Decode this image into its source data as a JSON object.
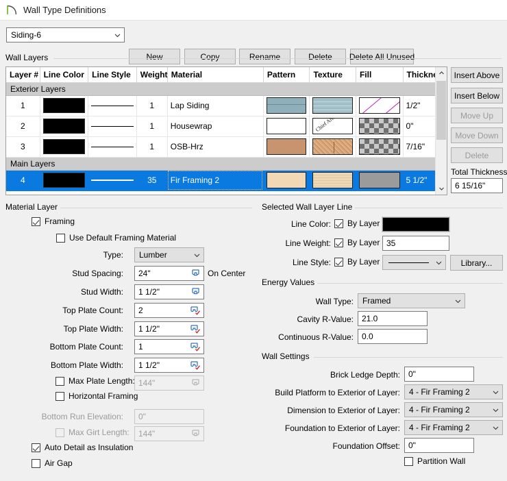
{
  "window": {
    "title": "Wall Type Definitions",
    "icon": "wall-arc-icon"
  },
  "toolbar": {
    "wall_type_value": "Siding-6",
    "buttons": [
      {
        "label": "New",
        "name": "new-button"
      },
      {
        "label": "Copy",
        "name": "copy-button"
      },
      {
        "label": "Rename",
        "name": "rename-button"
      },
      {
        "label": "Delete",
        "name": "delete-button"
      },
      {
        "label": "Delete All Unused",
        "name": "delete-all-unused-button"
      }
    ]
  },
  "wall_layers": {
    "group_title": "Wall Layers",
    "columns": [
      "Layer #",
      "Line Color",
      "Line Style",
      "Weight",
      "Material",
      "Pattern",
      "Texture",
      "Fill",
      "Thickness"
    ],
    "sections": [
      {
        "label": "Exterior Layers",
        "rows": [
          {
            "layer": "1",
            "line_color": "#000000",
            "line_style": "solid",
            "weight": "1",
            "material": "Lap Siding",
            "pattern": "lap-siding-pattern",
            "texture": "lap-siding-texture",
            "fill": "diagonal-magenta-fill",
            "thickness": "1/2\"",
            "selected": false
          },
          {
            "layer": "2",
            "line_color": "#000000",
            "line_style": "solid",
            "weight": "1",
            "material": "Housewrap",
            "pattern": "white-pattern",
            "texture": "housewrap-texture",
            "fill": "checker-fill",
            "thickness": "0\"",
            "selected": false
          },
          {
            "layer": "3",
            "line_color": "#000000",
            "line_style": "solid",
            "weight": "1",
            "material": "OSB-Hrz",
            "pattern": "osb-pattern",
            "texture": "osb-texture",
            "fill": "checker-fill",
            "thickness": "7/16\"",
            "selected": false
          }
        ]
      },
      {
        "label": "Main Layers",
        "rows": [
          {
            "layer": "4",
            "line_color": "#000000",
            "line_style": "solid",
            "weight": "35",
            "material": "Fir Framing 2",
            "pattern": "fir-pattern",
            "texture": "fir-texture",
            "fill": "gray-fill",
            "thickness": "5 1/2\"",
            "selected": true
          }
        ]
      }
    ],
    "texture_watermark": "Chief Architect"
  },
  "side_buttons": {
    "insert_above": "Insert Above",
    "insert_below": "Insert Below",
    "move_up": "Move Up",
    "move_down": "Move Down",
    "delete": "Delete",
    "total_thickness_label": "Total Thickness:",
    "total_thickness_value": "6 15/16\""
  },
  "material_layer": {
    "group_title": "Material Layer",
    "framing_label": "Framing",
    "framing_checked": true,
    "use_default_label": "Use Default Framing Material",
    "use_default_checked": false,
    "type_label": "Type:",
    "type_value": "Lumber",
    "stud_spacing_label": "Stud Spacing:",
    "stud_spacing_value": "24\"",
    "on_center_label": "On Center",
    "stud_width_label": "Stud Width:",
    "stud_width_value": "1 1/2\"",
    "top_plate_count_label": "Top Plate Count:",
    "top_plate_count_value": "2",
    "top_plate_width_label": "Top Plate Width:",
    "top_plate_width_value": "1 1/2\"",
    "bottom_plate_count_label": "Bottom Plate Count:",
    "bottom_plate_count_value": "1",
    "bottom_plate_width_label": "Bottom Plate Width:",
    "bottom_plate_width_value": "1 1/2\"",
    "max_plate_length_label": "Max Plate Length:",
    "max_plate_length_value": "144\"",
    "max_plate_length_checked": false,
    "horizontal_framing_label": "Horizontal Framing",
    "horizontal_framing_checked": false,
    "bottom_run_elevation_label": "Bottom Run Elevation:",
    "bottom_run_elevation_value": "0\"",
    "max_girt_length_label": "Max Girt Length:",
    "max_girt_length_value": "144\"",
    "max_girt_length_checked": false,
    "auto_detail_label": "Auto Detail as Insulation",
    "auto_detail_checked": true,
    "air_gap_label": "Air Gap",
    "air_gap_checked": false
  },
  "selected_wall_layer_line": {
    "group_title": "Selected Wall Layer Line",
    "by_layer_label": "By Layer",
    "line_color_label": "Line Color:",
    "line_color_by_layer": true,
    "line_color_value": "#000000",
    "line_weight_label": "Line Weight:",
    "line_weight_by_layer": true,
    "line_weight_value": "35",
    "line_style_label": "Line Style:",
    "line_style_by_layer": true,
    "line_style_value": "solid",
    "library_button": "Library..."
  },
  "energy_values": {
    "group_title": "Energy Values",
    "wall_type_label": "Wall Type:",
    "wall_type_value": "Framed",
    "cavity_label": "Cavity R-Value:",
    "cavity_value": "21.0",
    "continuous_label": "Continuous R-Value:",
    "continuous_value": "0.0"
  },
  "wall_settings": {
    "group_title": "Wall Settings",
    "brick_ledge_label": "Brick Ledge Depth:",
    "brick_ledge_value": "0\"",
    "build_platform_label": "Build Platform to Exterior of Layer:",
    "build_platform_value": "4 - Fir Framing 2",
    "dimension_label": "Dimension to Exterior of Layer:",
    "dimension_value": "4 - Fir Framing 2",
    "foundation_layer_label": "Foundation to Exterior of Layer:",
    "foundation_layer_value": "4 - Fir Framing 2",
    "foundation_offset_label": "Foundation Offset:",
    "foundation_offset_value": "0\"",
    "partition_wall_label": "Partition Wall",
    "partition_wall_checked": false
  },
  "colors": {
    "selection_blue": "#0a7ae0",
    "section_gray": "#cccccc",
    "dialog_bg": "#f0f0f0",
    "accent_green": "#6ab023"
  }
}
